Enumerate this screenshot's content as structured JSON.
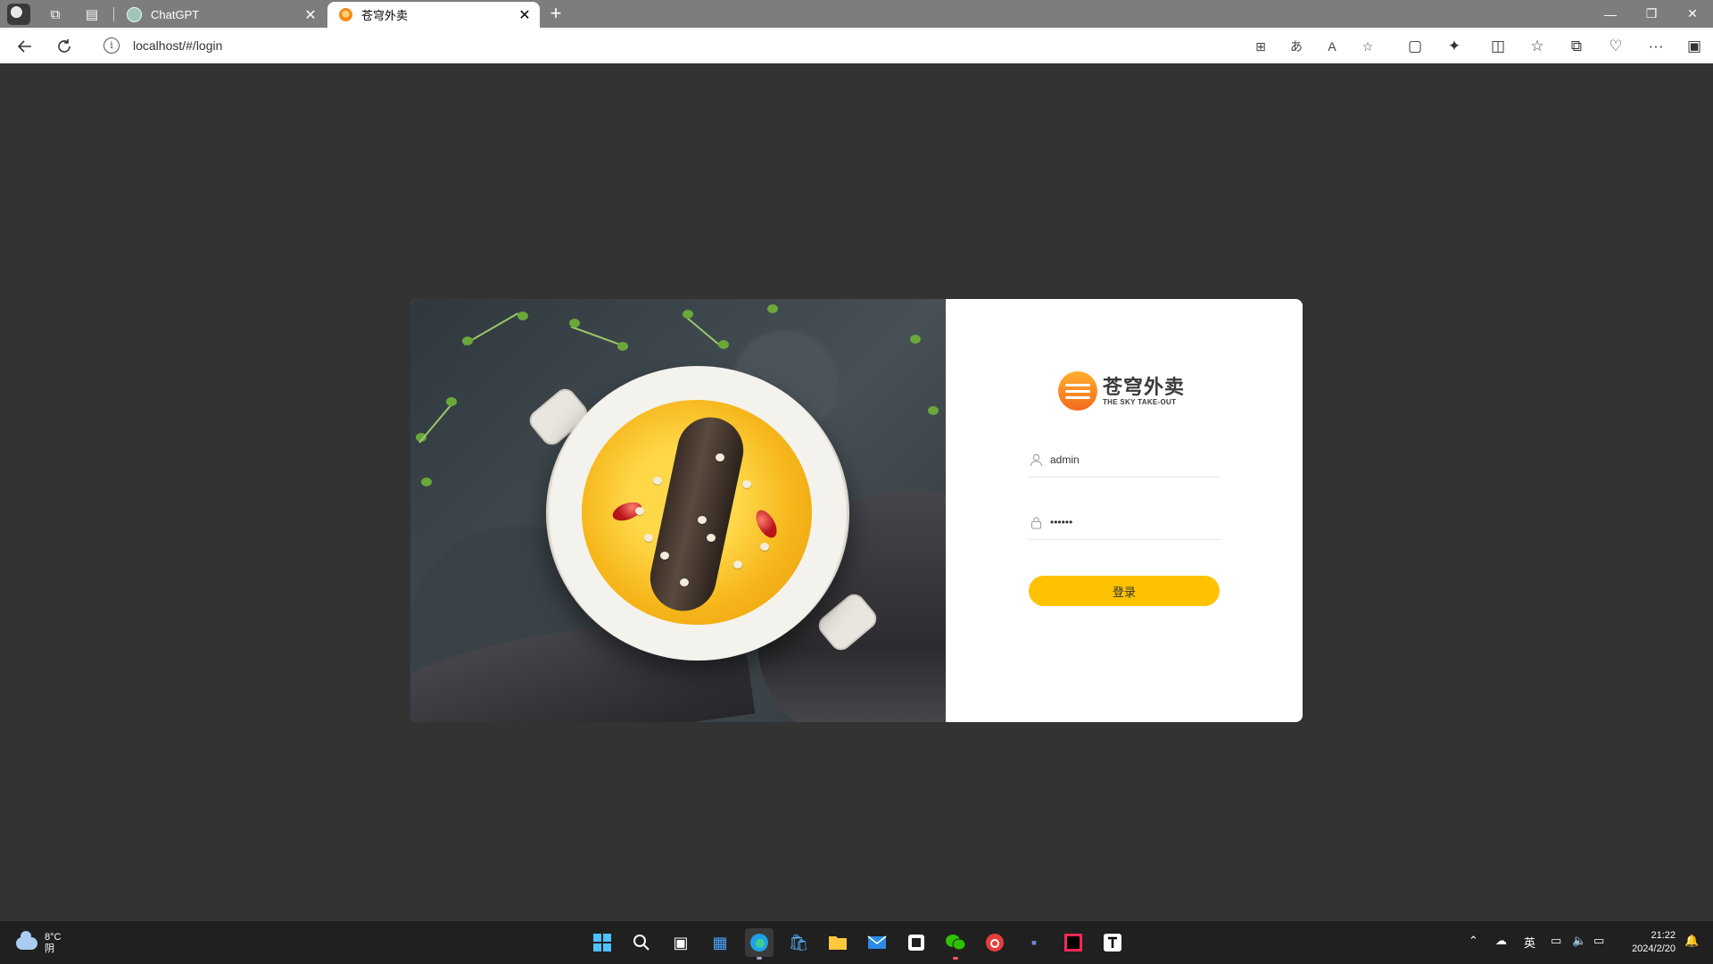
{
  "browser": {
    "tabs": [
      {
        "title": "ChatGPT",
        "active": false
      },
      {
        "title": "苍穹外卖",
        "active": true
      }
    ],
    "new_tab_label": "+",
    "window_controls": {
      "minimize": "—",
      "restore": "❐",
      "close": "✕"
    },
    "url": "localhost/#/login"
  },
  "login": {
    "logo": {
      "cn": "苍穹外卖",
      "en": "THE SKY TAKE-OUT"
    },
    "username": {
      "value": "admin"
    },
    "password": {
      "value": "123456"
    },
    "submit_label": "登录",
    "accent_color": "#ffc200"
  },
  "taskbar": {
    "weather": {
      "temp": "8°C",
      "condition": "阴"
    },
    "ime": "英",
    "time": "21:22",
    "date": "2024/2/20"
  }
}
